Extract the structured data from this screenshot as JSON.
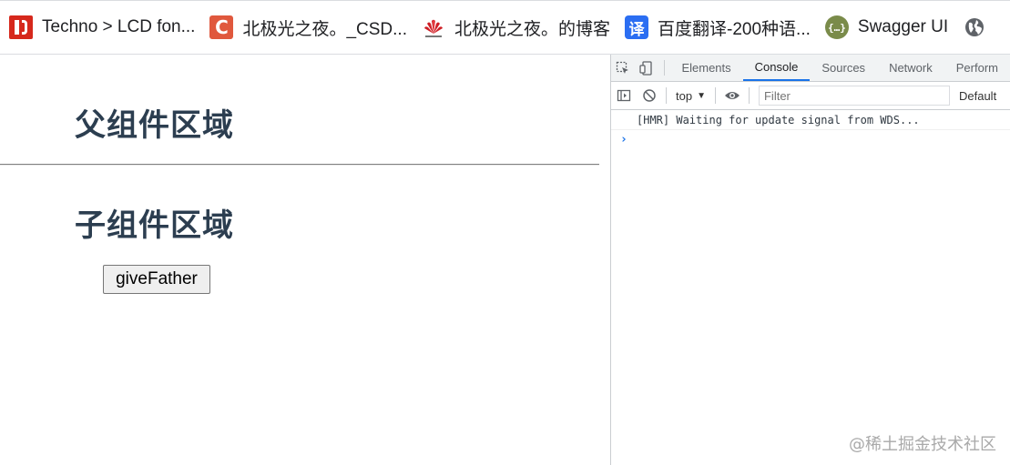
{
  "bookmarks": [
    {
      "label": "Techno > LCD fon...",
      "icon": "techno-logo-icon"
    },
    {
      "label": "北极光之夜。_CSD...",
      "icon": "csdn-logo-icon"
    },
    {
      "label": "北极光之夜。的博客",
      "icon": "huawei-logo-icon"
    },
    {
      "label": "百度翻译-200种语...",
      "icon": "baidu-translate-icon"
    },
    {
      "label": "Swagger UI",
      "icon": "swagger-logo-icon"
    },
    {
      "label": "",
      "icon": "globe-icon"
    }
  ],
  "page": {
    "parent_title": "父组件区域",
    "child_title": "子组件区域",
    "button_label": "giveFather"
  },
  "devtools": {
    "tabs": [
      "Elements",
      "Console",
      "Sources",
      "Network",
      "Perform"
    ],
    "active_tab": "Console",
    "context": "top",
    "filter_placeholder": "Filter",
    "levels": "Default",
    "messages": [
      "[HMR] Waiting for update signal from WDS..."
    ],
    "prompt": "›"
  },
  "watermark": "@稀土掘金技术社区",
  "colors": {
    "heading": "#2c3e50",
    "active_tab_underline": "#1a73e8"
  }
}
